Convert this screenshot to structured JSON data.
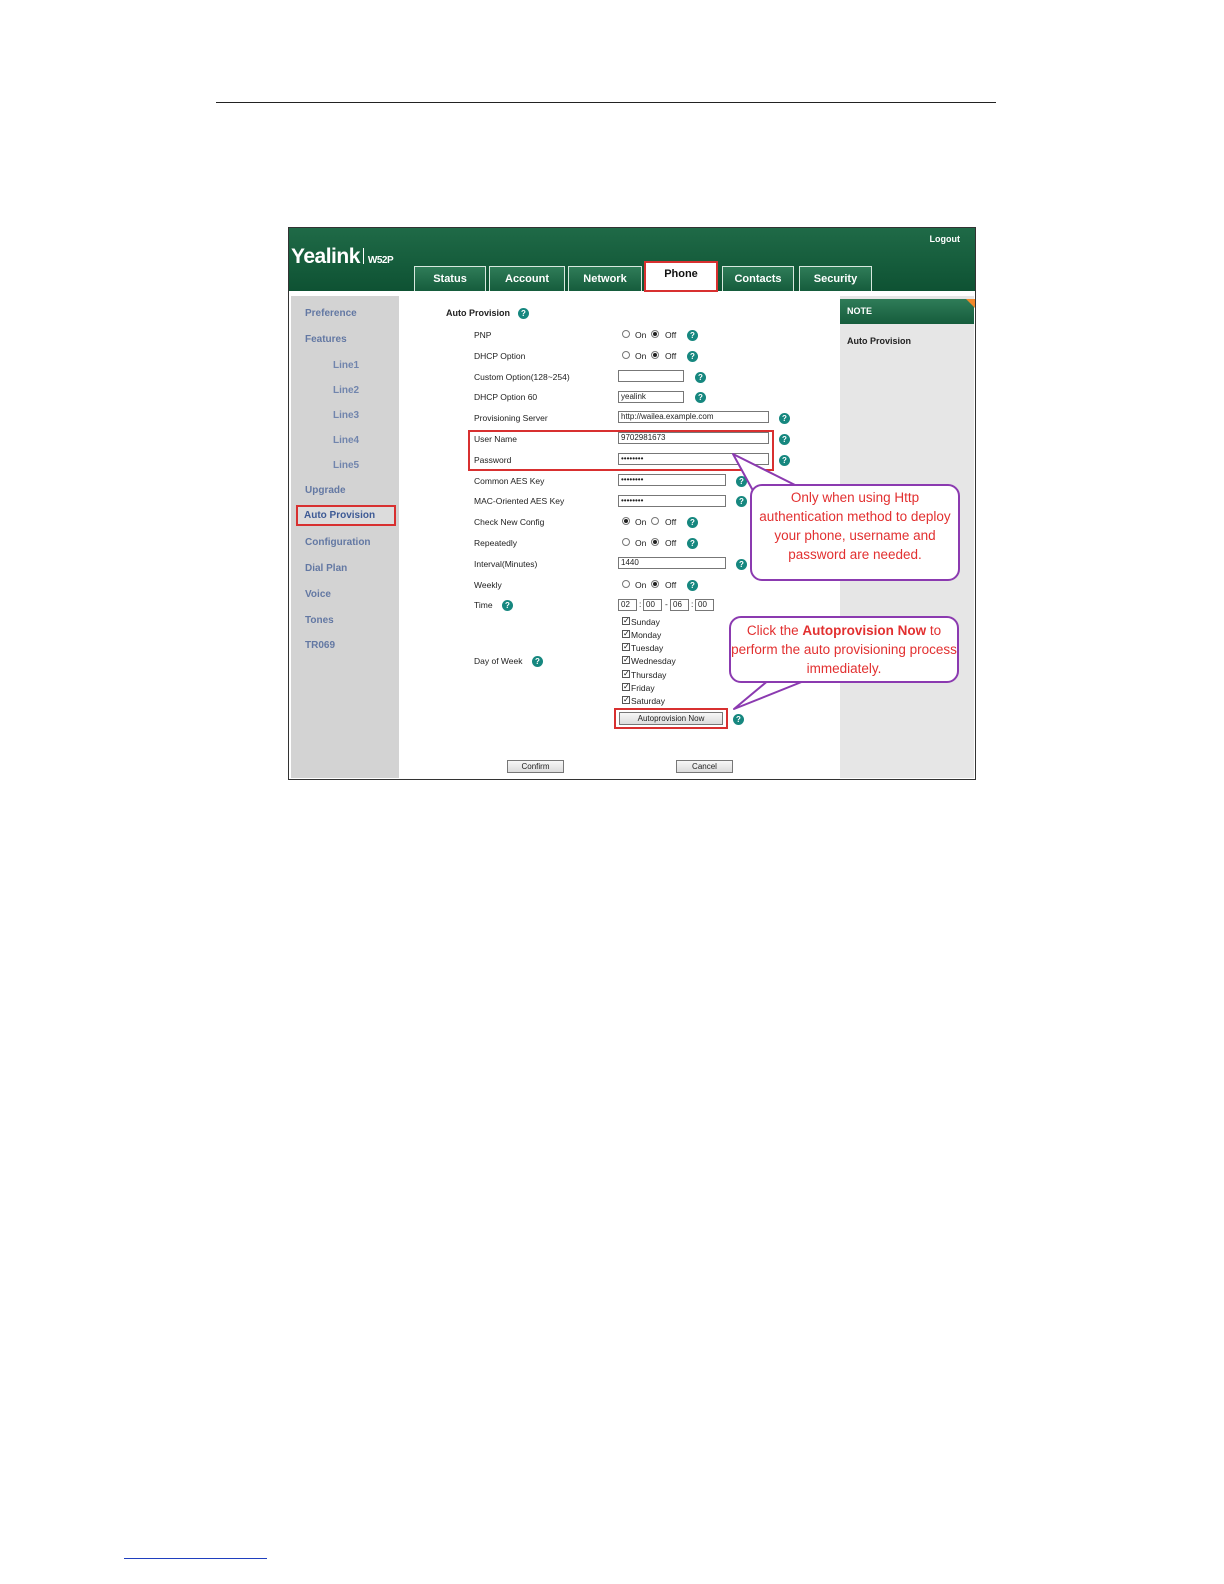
{
  "app": {
    "logo": "Yealink",
    "model": "W52P",
    "logout": "Logout"
  },
  "tabs": [
    {
      "label": "Status"
    },
    {
      "label": "Account"
    },
    {
      "label": "Network"
    },
    {
      "label": "Phone",
      "active": true
    },
    {
      "label": "Contacts"
    },
    {
      "label": "Security"
    }
  ],
  "sidebar": {
    "items": [
      {
        "label": "Preference"
      },
      {
        "label": "Features"
      },
      {
        "label": "Line1"
      },
      {
        "label": "Line2"
      },
      {
        "label": "Line3"
      },
      {
        "label": "Line4"
      },
      {
        "label": "Line5"
      },
      {
        "label": "Upgrade"
      },
      {
        "label": "Auto Provision",
        "active": true
      },
      {
        "label": "Configuration"
      },
      {
        "label": "Dial Plan"
      },
      {
        "label": "Voice"
      },
      {
        "label": "Tones"
      },
      {
        "label": "TR069"
      }
    ]
  },
  "form": {
    "title": "Auto Provision",
    "on_label": "On",
    "off_label": "Off",
    "pnp": {
      "label": "PNP",
      "value": "Off"
    },
    "dhcp_option": {
      "label": "DHCP Option",
      "value": "Off"
    },
    "custom_option": {
      "label": "Custom Option(128~254)",
      "value": ""
    },
    "dhcp_option60": {
      "label": "DHCP Option 60",
      "value": "yealink"
    },
    "server": {
      "label": "Provisioning Server",
      "value": "http://wailea.example.com"
    },
    "username": {
      "label": "User Name",
      "value": "9702981673"
    },
    "password": {
      "label": "Password",
      "value": "••••••••"
    },
    "common_aes": {
      "label": "Common AES Key",
      "value": "••••••••"
    },
    "mac_aes": {
      "label": "MAC-Oriented AES Key",
      "value": "••••••••"
    },
    "check_new_config": {
      "label": "Check New Config",
      "value": "On"
    },
    "repeatedly": {
      "label": "Repeatedly",
      "value": "Off"
    },
    "interval": {
      "label": "Interval(Minutes)",
      "value": "1440"
    },
    "weekly": {
      "label": "Weekly",
      "value": "Off"
    },
    "time": {
      "label": "Time",
      "start_h": "02",
      "start_m": "00",
      "end_h": "06",
      "end_m": "00",
      "colon": ":",
      "dash": "-"
    },
    "day_of_week": {
      "label": "Day of Week",
      "days": [
        {
          "label": "Sunday",
          "checked": true
        },
        {
          "label": "Monday",
          "checked": true
        },
        {
          "label": "Tuesday",
          "checked": true
        },
        {
          "label": "Wednesday",
          "checked": true
        },
        {
          "label": "Thursday",
          "checked": true
        },
        {
          "label": "Friday",
          "checked": true
        },
        {
          "label": "Saturday",
          "checked": true
        }
      ]
    },
    "autoprovision_button": "Autoprovision Now",
    "confirm_button": "Confirm",
    "cancel_button": "Cancel",
    "help_glyph": "?",
    "check_glyph": "✓"
  },
  "note": {
    "header": "NOTE",
    "text": "Auto Provision"
  },
  "callouts": {
    "http": "Only when using Http authentication method to deploy your phone, username and password are needed.",
    "autoprov_pre": "Click the ",
    "autoprov_bold": "Autoprovision Now",
    "autoprov_post": " to perform the auto provisioning process immediately."
  },
  "colors": {
    "header_green": "#0e5233",
    "highlight_red": "#d83030",
    "callout_border": "#8b3ab0",
    "callout_text": "#e23030",
    "help_teal": "#16877f"
  }
}
